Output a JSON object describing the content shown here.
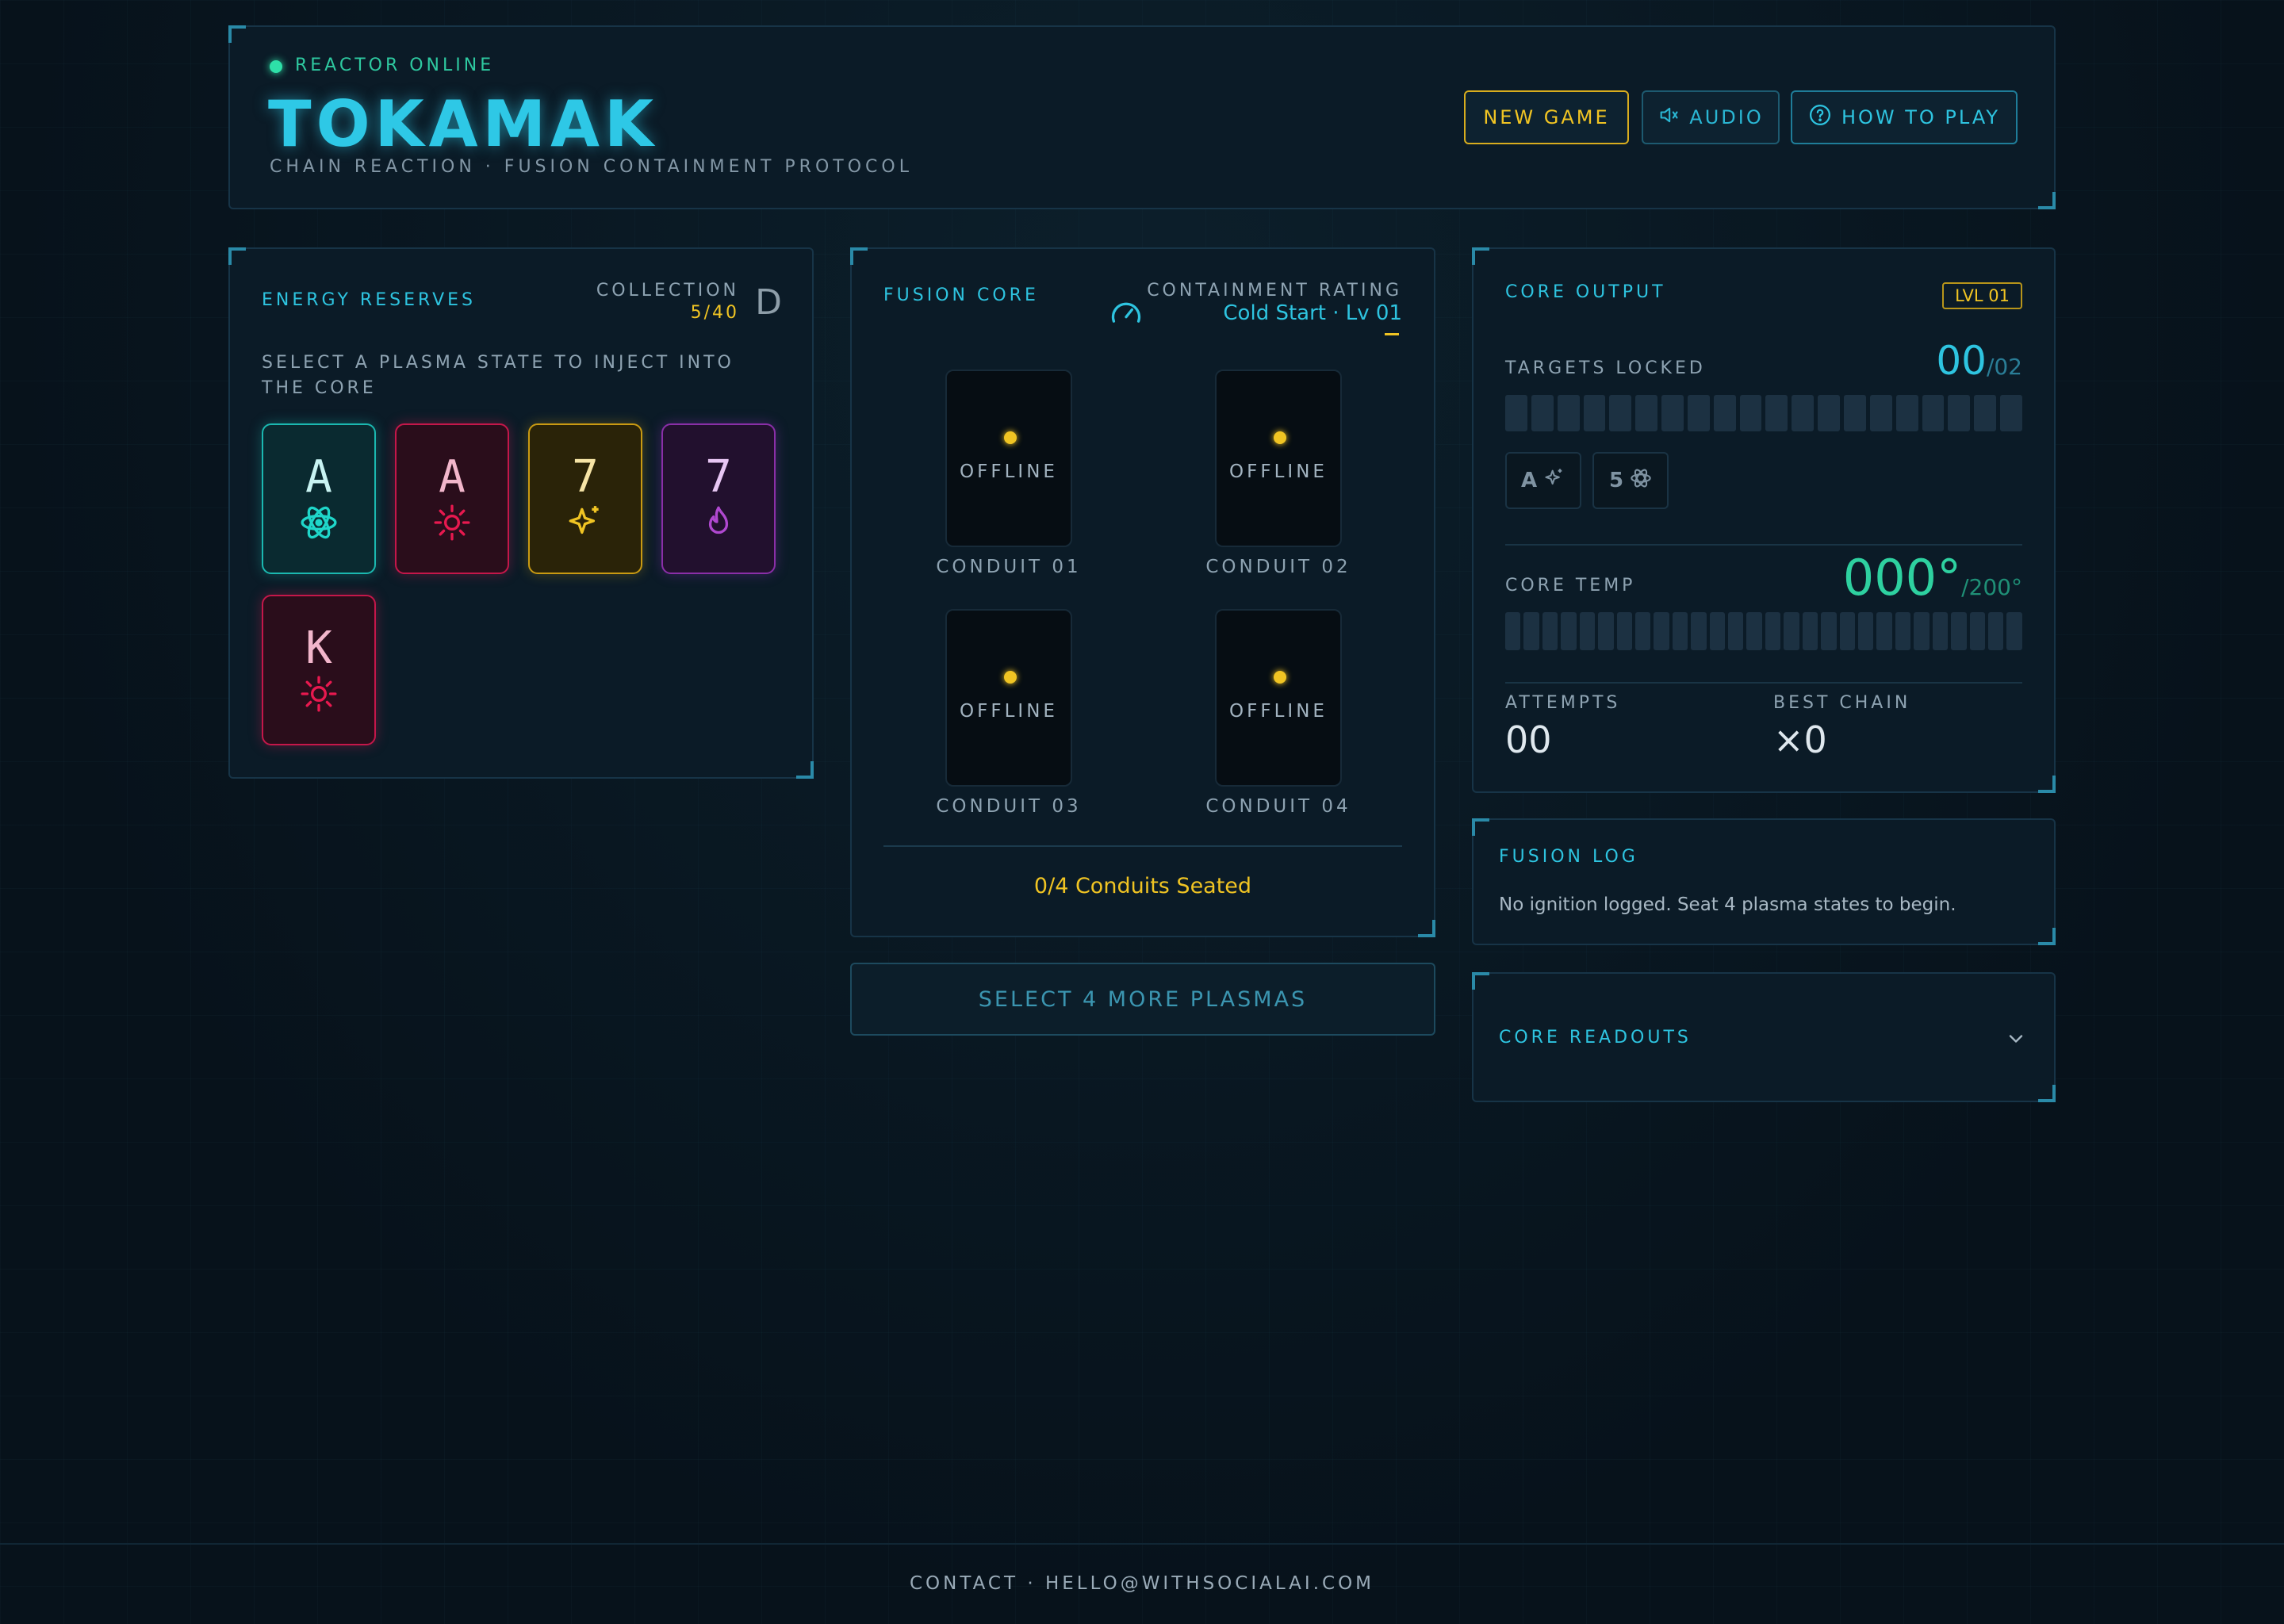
{
  "header": {
    "status": "REACTOR ONLINE",
    "title": "TOKAMAK",
    "subtitle": "CHAIN REACTION · FUSION CONTAINMENT PROTOCOL",
    "buttons": {
      "new_game": "NEW GAME",
      "audio": "AUDIO",
      "how_to_play": "HOW TO PLAY"
    }
  },
  "energy": {
    "title": "ENERGY RESERVES",
    "collection_label": "COLLECTION",
    "collection_value": "5/40",
    "collection_grade": "D",
    "instruction": "SELECT A PLASMA STATE TO INJECT INTO THE CORE",
    "cards": [
      {
        "rank": "A",
        "icon": "atom-icon",
        "color": "#1fd6c9"
      },
      {
        "rank": "A",
        "icon": "sun-icon",
        "color": "#e8194f"
      },
      {
        "rank": "7",
        "icon": "sparkle-icon",
        "color": "#f0c423"
      },
      {
        "rank": "7",
        "icon": "flame-icon",
        "color": "#b048d0"
      },
      {
        "rank": "K",
        "icon": "sun-icon",
        "color": "#e8194f"
      }
    ]
  },
  "fusion": {
    "title": "FUSION CORE",
    "rating_label": "CONTAINMENT RATING",
    "rating_value": "Cold Start · Lv 01",
    "conduits": [
      {
        "status": "OFFLINE",
        "label": "CONDUIT 01"
      },
      {
        "status": "OFFLINE",
        "label": "CONDUIT 02"
      },
      {
        "status": "OFFLINE",
        "label": "CONDUIT 03"
      },
      {
        "status": "OFFLINE",
        "label": "CONDUIT 04"
      }
    ],
    "seated": "0/4 Conduits Seated",
    "select_button": "SELECT 4 MORE PLASMAS"
  },
  "output": {
    "title": "CORE OUTPUT",
    "level": "LVL 01",
    "targets_label": "TARGETS LOCKED",
    "targets_value": "00",
    "targets_max": "/02",
    "targets": [
      {
        "rank": "A",
        "icon": "sparkle-icon"
      },
      {
        "rank": "5",
        "icon": "atom-icon"
      }
    ],
    "temp_label": "CORE TEMP",
    "temp_value": "000°",
    "temp_max": "/200°",
    "attempts_label": "ATTEMPTS",
    "attempts_value": "00",
    "best_label": "BEST CHAIN",
    "best_value": "×0"
  },
  "log": {
    "title": "FUSION LOG",
    "message": "No ignition logged. Seat 4 plasma states to begin."
  },
  "readouts": {
    "title": "CORE READOUTS"
  },
  "footer": {
    "contact": "CONTACT · HELLO@WITHSOCIALAI.COM"
  },
  "colors": {
    "accent": "#2ec4e0",
    "warning": "#f0c423",
    "online": "#2ee0a8",
    "temp": "#2ed1a0"
  }
}
